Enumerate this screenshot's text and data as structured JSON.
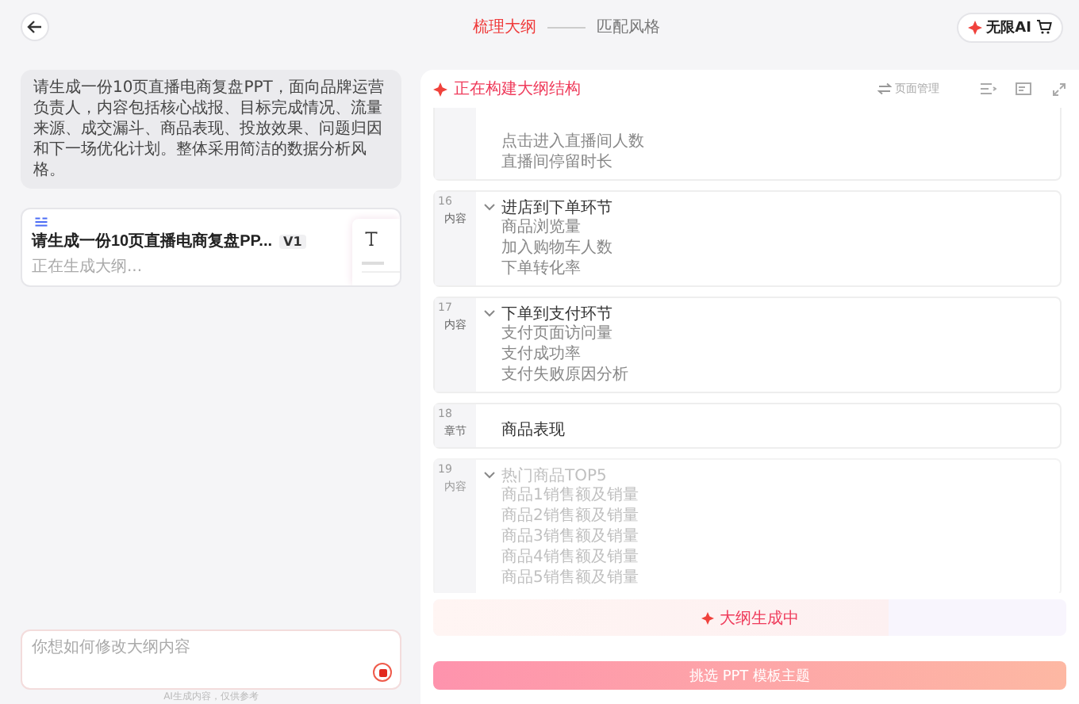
{
  "header": {
    "steps": [
      {
        "label": "梳理大纲",
        "selected": true
      },
      {
        "label": "匹配风格",
        "selected": false
      }
    ],
    "upgrade_button": "无限AI"
  },
  "chat": {
    "prompt": "请生成一份10页直播电商复盘PPT，面向品牌运营负责人，内容包括核心战报、目标完成情况、流量来源、成交漏斗、商品表现、投放效果、问题归因和下一场优化计划。整体采用简洁的数据分析风格。",
    "outline_card": {
      "title": "请生成一份10页直播电商复盘PP...",
      "version": "V1",
      "status": "正在生成大纲..."
    },
    "input": {
      "placeholder": "你想如何修改大纲内容"
    },
    "footnote": "AI生成内容，仅供参考"
  },
  "outline": {
    "status": "正在构建大纲结构",
    "page_manage": "页面管理",
    "sections": [
      {
        "kind": "content",
        "items": [
          "点击进入直播间人数",
          "直播间停留时长"
        ],
        "faded": false
      },
      {
        "kind": "content",
        "number": "16",
        "label": "内容",
        "heading": "进店到下单环节",
        "items": [
          "商品浏览量",
          "加入购物车人数",
          "下单转化率"
        ],
        "faded": false
      },
      {
        "kind": "content",
        "number": "17",
        "label": "内容",
        "heading": "下单到支付环节",
        "items": [
          "支付页面访问量",
          "支付成功率",
          "支付失败原因分析"
        ],
        "faded": false
      },
      {
        "kind": "chapter",
        "number": "18",
        "label": "章节",
        "heading": "商品表现",
        "faded": false
      },
      {
        "kind": "content",
        "number": "19",
        "label": "内容",
        "heading": "热门商品TOP5",
        "items": [
          "商品1销售额及销量",
          "商品2销售额及销量",
          "商品3销售额及销量",
          "商品4销售额及销量",
          "商品5销售额及销量"
        ],
        "faded": true
      }
    ],
    "generating": {
      "label": "大纲生成中",
      "level": 0.72
    },
    "submit_button": "挑选 PPT 模板主题"
  }
}
